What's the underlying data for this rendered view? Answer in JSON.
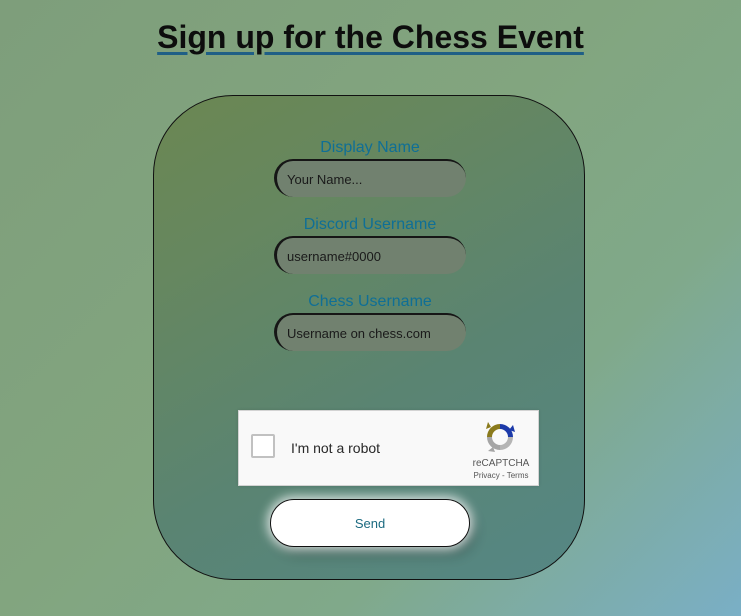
{
  "page": {
    "title": "Sign up for the Chess Event"
  },
  "form": {
    "display_name": {
      "label": "Display Name",
      "placeholder": "Your Name..."
    },
    "discord_username": {
      "label": "Discord Username",
      "placeholder": "username#0000"
    },
    "chess_username": {
      "label": "Chess Username",
      "placeholder": "Username on chess.com"
    },
    "recaptcha": {
      "label": "I'm not a robot",
      "brand": "reCAPTCHA",
      "privacy_link": "Privacy",
      "separator": " - ",
      "terms_link": "Terms",
      "checked": false
    },
    "send_label": "Send"
  },
  "colors": {
    "label": "#0f6f96",
    "title_underline": "#1f5f86",
    "send_text": "#1b6a80"
  }
}
